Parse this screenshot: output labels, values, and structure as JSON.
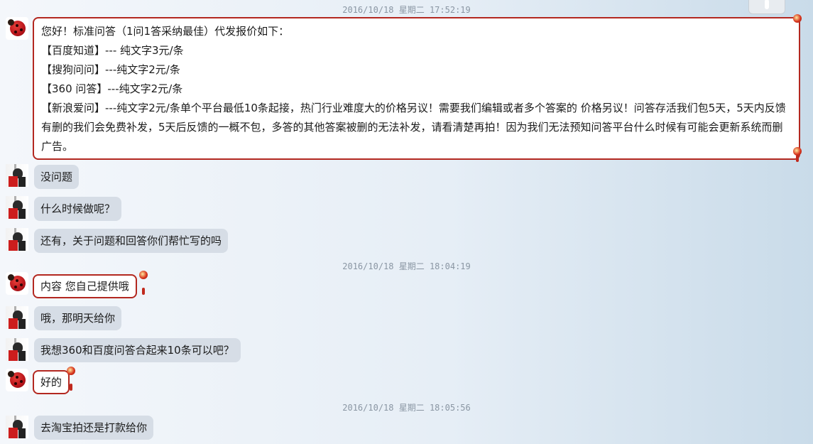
{
  "timestamps": [
    "2016/10/18 星期二 17:52:19",
    "2016/10/18 星期二 18:04:19",
    "2016/10/18 星期二 18:05:56"
  ],
  "messages": {
    "m1": {
      "lines": [
        "您好！标准问答（1问1答采纳最佳）代发报价如下：",
        "【百度知道】--- 纯文字3元/条",
        "【搜狗问问】---纯文字2元/条",
        "【360 问答】---纯文字2元/条",
        "【新浪爱问】---纯文字2元/条单个平台最低10条起接，热门行业难度大的价格另议！需要我们编辑或者多个答案的 价格另议！问答存活我们包5天，5天内反馈有删的我们会免费补发，5天后反馈的一概不包，多答的其他答案被删的无法补发，请看清楚再拍！因为我们无法预知问答平台什么时候有可能会更新系统而删广告。"
      ]
    },
    "m2": "没问题",
    "m3": "什么时候做呢？",
    "m4": "还有，关于问题和回答你们帮忙写的吗",
    "m5": "内容 您自己提供哦",
    "m6": "哦，那明天给你",
    "m7": "我想360和百度问答合起来10条可以吧？",
    "m8": "好的",
    "m9": "去淘宝拍还是打款给你"
  },
  "colors": {
    "seller_border": "#b32820",
    "buyer_bubble": "#d6dde6",
    "timestamp": "#8a96a3"
  },
  "icons": {
    "seller_avatar": "ladybug-avatar-icon",
    "buyer_avatar": "person-avatar-icon",
    "bubble_decoration": "chinese-knot-icon"
  }
}
